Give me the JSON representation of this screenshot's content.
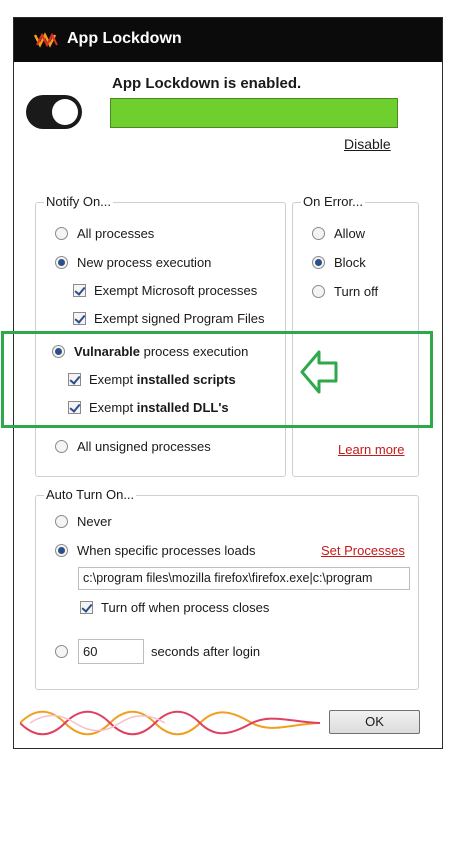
{
  "window": {
    "title": "App Lockdown"
  },
  "status": {
    "text": "App Lockdown is enabled.",
    "enabled": true,
    "bar_color": "#6fcf2e",
    "disable_label": "Disable"
  },
  "notify_on": {
    "label": "Notify On...",
    "all_processes": "All processes",
    "new_process": "New process execution",
    "exempt_microsoft": "Exempt Microsoft processes",
    "exempt_signed": "Exempt signed Program Files",
    "vulnerable_bold": "Vulnarable",
    "vulnerable_rest": " process execution",
    "exempt_scripts_a": "Exempt",
    "exempt_scripts_b": "installed scripts",
    "exempt_dlls_a": "Exempt",
    "exempt_dlls_b": "installed DLL's",
    "all_unsigned": "All unsigned processes"
  },
  "on_error": {
    "label": "On Error...",
    "allow": "Allow",
    "block": "Block",
    "turn_off": "Turn off",
    "learn_more": "Learn more"
  },
  "auto_turn_on": {
    "label": "Auto Turn On...",
    "never": "Never",
    "specific": "When specific processes loads",
    "set_processes": "Set Processes",
    "process_path": "c:\\program files\\mozilla firefox\\firefox.exe|c:\\program",
    "turn_off_closes": "Turn off when process closes",
    "seconds_value": "60",
    "seconds_label": "seconds after login"
  },
  "buttons": {
    "ok": "OK"
  },
  "colors": {
    "highlight": "#2ea84a",
    "link_red": "#c41a1a"
  }
}
